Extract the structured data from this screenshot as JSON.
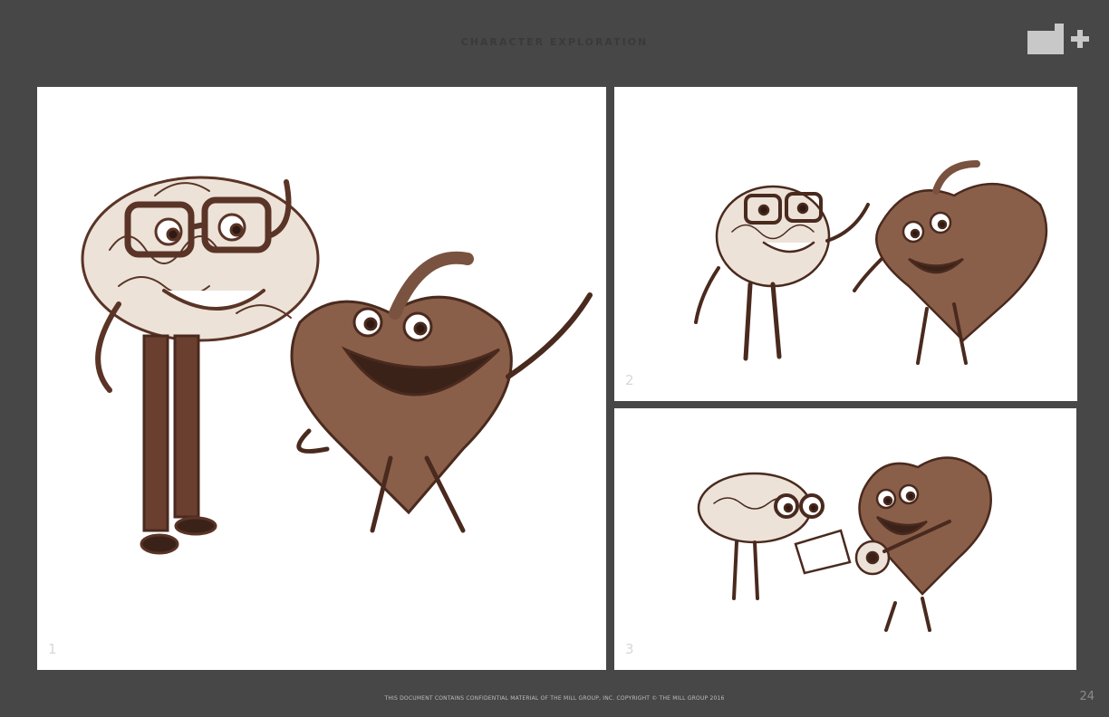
{
  "header": {
    "title": "CHARACTER EXPLORATION",
    "logo_icon": "mill-plus-logo"
  },
  "panels": [
    {
      "number": "1",
      "image": "brain-and-heart-characters-waving-sketch"
    },
    {
      "number": "2",
      "image": "brain-and-heart-characters-high-five-sketch"
    },
    {
      "number": "3",
      "image": "brain-and-heart-characters-playing-banjo-sketch"
    }
  ],
  "footer": {
    "notice": "THIS DOCUMENT CONTAINS CONFIDENTIAL MATERIAL OF THE MILL GROUP, INC. COPYRIGHT © THE MILL GROUP 2016",
    "page_number": "24"
  },
  "colors": {
    "background": "#474747",
    "panel": "#ffffff",
    "sketch_brown": "#6b3f2f",
    "brain_fill": "#ece2d8",
    "heart_fill": "#8a5f4a"
  }
}
